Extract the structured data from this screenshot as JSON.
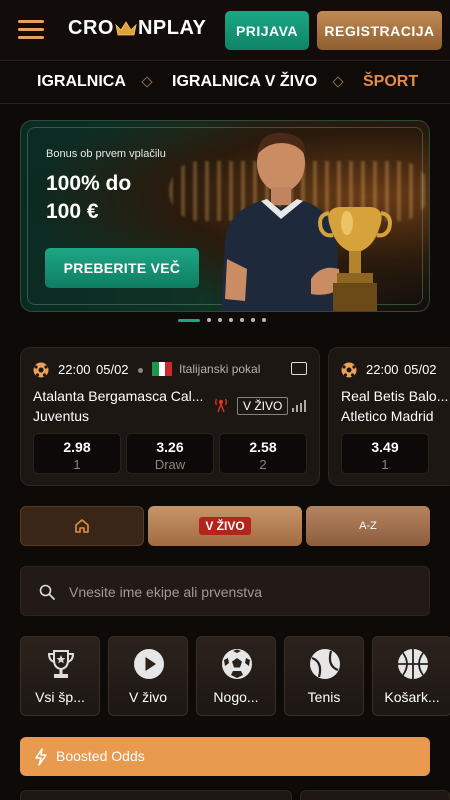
{
  "header": {
    "logo_pre": "CRO",
    "logo_post": "NPLAY",
    "login_label": "PRIJAVA",
    "register_label": "REGISTRACIJA"
  },
  "nav": {
    "items": [
      {
        "label": "IGRALNICA",
        "active": false
      },
      {
        "label": "IGRALNICA V ŽIVO",
        "active": false
      },
      {
        "label": "ŠPORT",
        "active": true
      }
    ]
  },
  "banner": {
    "subtitle": "Bonus ob prvem vplačilu",
    "headline": "100% do 100 €",
    "cta_label": "PREBERITE VEČ",
    "slide_count": 7,
    "active_slide": 0
  },
  "matches": [
    {
      "time": "22:00",
      "date": "05/02",
      "league": "Italijanski pokal",
      "home": "Atalanta Bergamasca Cal...",
      "away": "Juventus",
      "live_label": "V ŽIVO",
      "odds": [
        {
          "value": "2.98",
          "label": "1"
        },
        {
          "value": "3.26",
          "label": "Draw"
        },
        {
          "value": "2.58",
          "label": "2"
        }
      ]
    },
    {
      "time": "22:00",
      "date": "05/02",
      "home": "Real Betis Balo...",
      "away": "Atletico Madrid",
      "odds": [
        {
          "value": "3.49",
          "label": "1"
        }
      ]
    }
  ],
  "filters": {
    "live_label": "V ŽIVO",
    "az_label": "A-Z"
  },
  "search": {
    "placeholder": "Vnesite ime ekipe ali prvenstva"
  },
  "sports": [
    {
      "label": "Vsi šp...",
      "icon": "trophy-icon"
    },
    {
      "label": "V živo",
      "icon": "play-icon"
    },
    {
      "label": "Nogo...",
      "icon": "football-icon"
    },
    {
      "label": "Tenis",
      "icon": "tennis-icon"
    },
    {
      "label": "Košark...",
      "icon": "basketball-icon"
    }
  ],
  "boosted": {
    "label": "Boosted Odds"
  },
  "colors": {
    "accent_green": "#1aa784",
    "accent_gold": "#c08a52",
    "active_nav": "#e38b4a",
    "boosted": "#e89a4f"
  }
}
